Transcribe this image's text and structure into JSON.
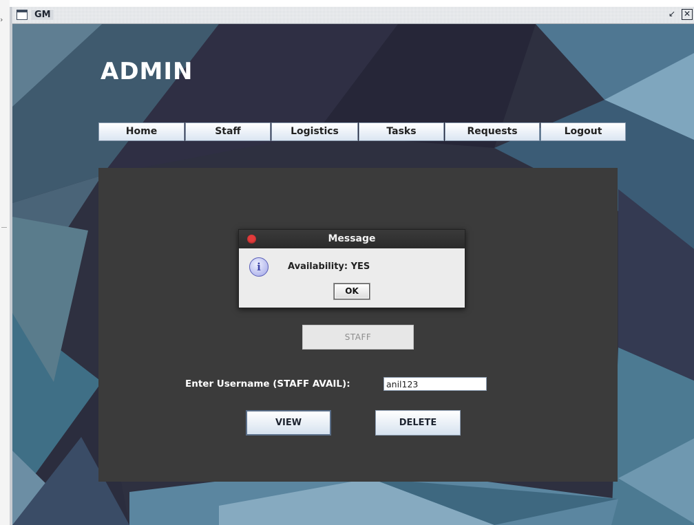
{
  "window": {
    "title": "GM"
  },
  "header": {
    "title": "ADMIN"
  },
  "nav": {
    "items": [
      "Home",
      "Staff",
      "Logistics",
      "Tasks",
      "Requests",
      "Logout"
    ]
  },
  "panel": {
    "staff_button": "STAFF",
    "username_label": "Enter Username (STAFF AVAIL):",
    "username_value": "anil123",
    "view_button": "VIEW",
    "delete_button": "DELETE"
  },
  "dialog": {
    "title": "Message",
    "message": "Availability: YES",
    "ok_button": "OK",
    "icon": "info-icon"
  },
  "colors": {
    "panel_bg": "#3b3b3b",
    "close_dot": "#e23b3b"
  }
}
